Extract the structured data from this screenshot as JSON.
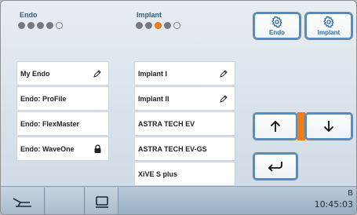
{
  "modes": {
    "endo": {
      "title": "Endo",
      "dots": [
        "filled",
        "filled",
        "filled",
        "filled",
        "empty"
      ]
    },
    "implant": {
      "title": "Implant",
      "dots": [
        "filled",
        "filled",
        "active",
        "filled",
        "empty"
      ]
    }
  },
  "config_buttons": {
    "endo": {
      "label": "Endo",
      "icon": "gear-icon"
    },
    "implant": {
      "label": "Implant",
      "icon": "gear-icon"
    }
  },
  "endo_list": [
    {
      "label": "My Endo",
      "icon": "pencil-icon"
    },
    {
      "label": "Endo: ProFile",
      "icon": ""
    },
    {
      "label": "Endo: FlexMaster",
      "icon": ""
    },
    {
      "label": "Endo: WaveOne",
      "icon": "lock-icon"
    }
  ],
  "implant_list": [
    {
      "label": "Implant I",
      "icon": "pencil-icon"
    },
    {
      "label": "Implant II",
      "icon": "pencil-icon"
    },
    {
      "label": "ASTRA TECH EV",
      "icon": ""
    },
    {
      "label": "ASTRA TECH EV-GS",
      "icon": ""
    },
    {
      "label": "XiVE S plus",
      "icon": ""
    }
  ],
  "navigation": {
    "up": "arrow-up-icon",
    "down": "arrow-down-icon",
    "back": "return-arrow-icon"
  },
  "status": {
    "letter": "B",
    "time": "10:45:03"
  },
  "colors": {
    "accent": "#f07d1c",
    "title_blue": "#2f5f86",
    "button_blue": "#4c8fce"
  }
}
